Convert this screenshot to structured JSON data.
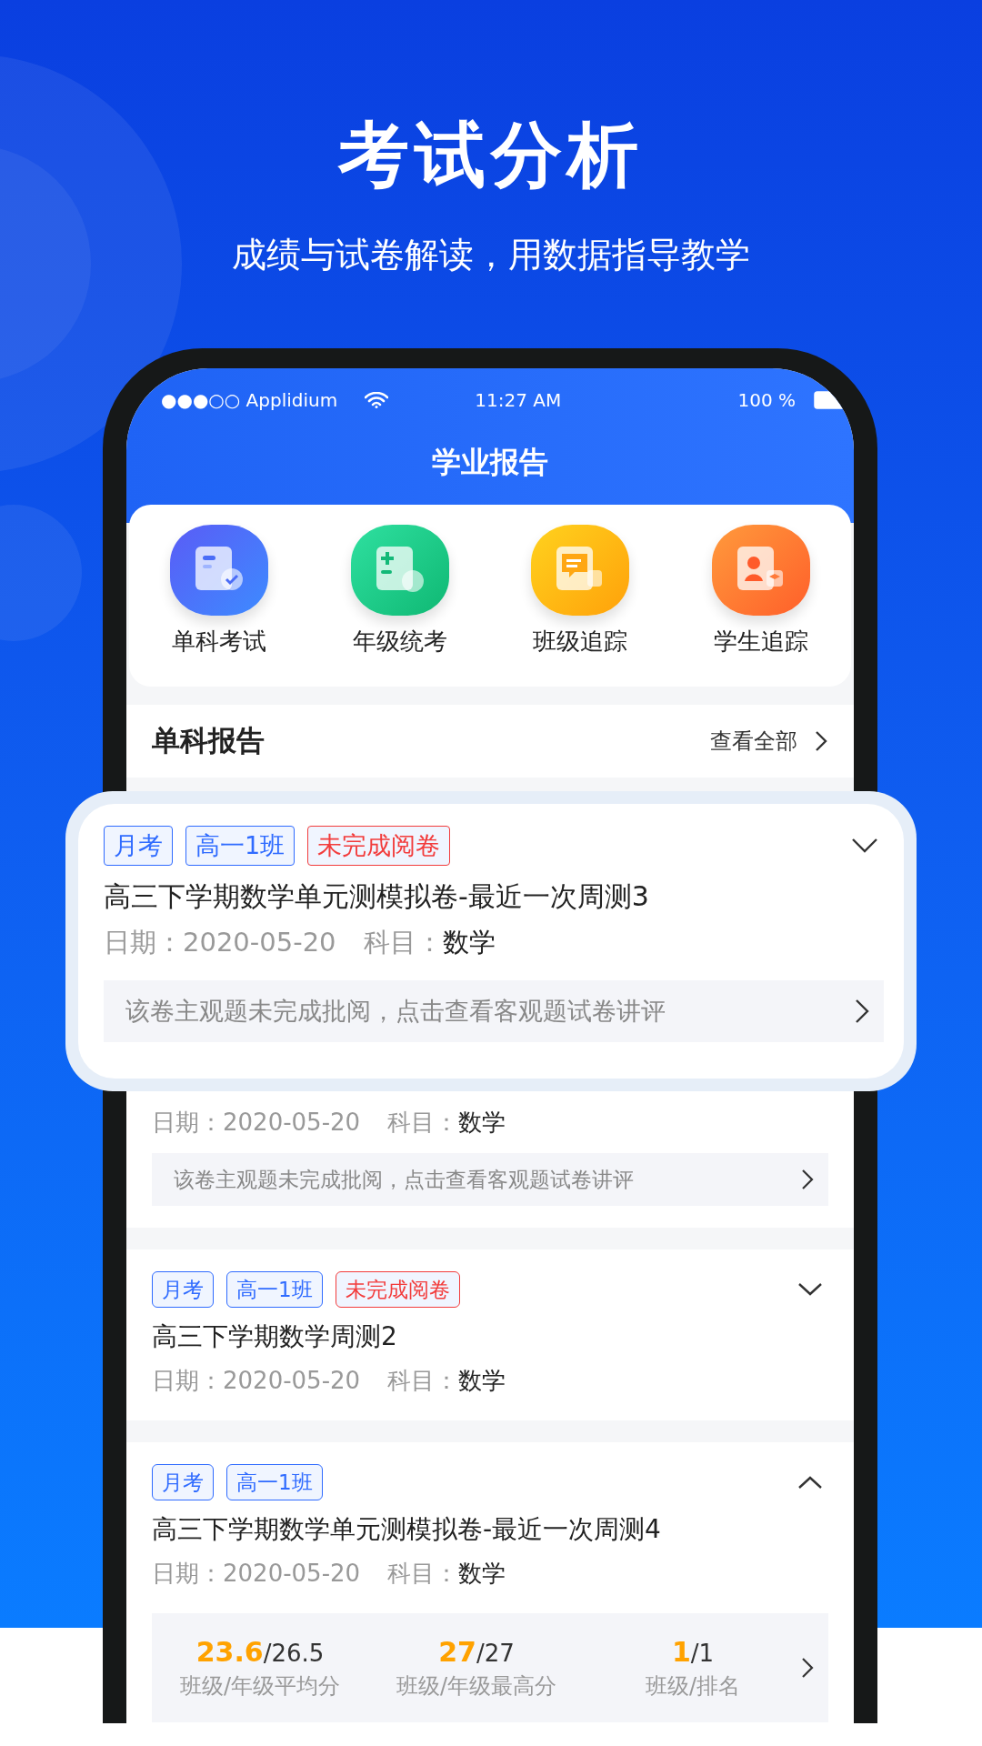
{
  "poster": {
    "title": "考试分析",
    "subtitle": "成绩与试卷解读，用数据指导教学"
  },
  "status_bar": {
    "carrier": "●●●○○ Applidium",
    "time": "11:27 AM",
    "battery": "100 %"
  },
  "header": {
    "title": "学业报告"
  },
  "shortcuts": [
    {
      "label": "单科考试",
      "kind": "exam"
    },
    {
      "label": "年级统考",
      "kind": "grade"
    },
    {
      "label": "班级追踪",
      "kind": "class"
    },
    {
      "label": "学生追踪",
      "kind": "student"
    }
  ],
  "section": {
    "title": "单科报告",
    "link": "查看全部"
  },
  "featured_report": {
    "tags": [
      {
        "text": "月考",
        "color": "#2f6bff"
      },
      {
        "text": "高一1班",
        "color": "#2f6bff"
      },
      {
        "text": "未完成阅卷",
        "color": "#f23c3c"
      }
    ],
    "title": "高三下学期数学单元测模拟卷-最近一次周测3",
    "date_label": "日期：",
    "date": "2020-05-20",
    "subject_label": "科目：",
    "subject": "数学",
    "note": "该卷主观题未完成批阅，点击查看客观题试卷讲评",
    "expanded": false
  },
  "reports": [
    {
      "date_label": "日期：",
      "date": "2020-05-20",
      "subject_label": "科目：",
      "subject": "数学",
      "note": "该卷主观题未完成批阅，点击查看客观题试卷讲评"
    },
    {
      "tags": [
        {
          "text": "月考",
          "color": "#2f6bff"
        },
        {
          "text": "高一1班",
          "color": "#2f6bff"
        },
        {
          "text": "未完成阅卷",
          "color": "#f23c3c"
        }
      ],
      "title": "高三下学期数学周测2",
      "date_label": "日期：",
      "date": "2020-05-20",
      "subject_label": "科目：",
      "subject": "数学",
      "expanded": false
    },
    {
      "tags": [
        {
          "text": "月考",
          "color": "#2f6bff"
        },
        {
          "text": "高一1班",
          "color": "#2f6bff"
        }
      ],
      "title": "高三下学期数学单元测模拟卷-最近一次周测4",
      "date_label": "日期：",
      "date": "2020-05-20",
      "subject_label": "科目：",
      "subject": "数学",
      "expanded": true,
      "stats": [
        {
          "value": "23.6",
          "total": "/26.5",
          "label": "班级/年级平均分"
        },
        {
          "value": "27",
          "total": "/27",
          "label": "班级/年级最高分"
        },
        {
          "value": "1",
          "total": "/1",
          "label": "班级/排名"
        }
      ]
    }
  ]
}
